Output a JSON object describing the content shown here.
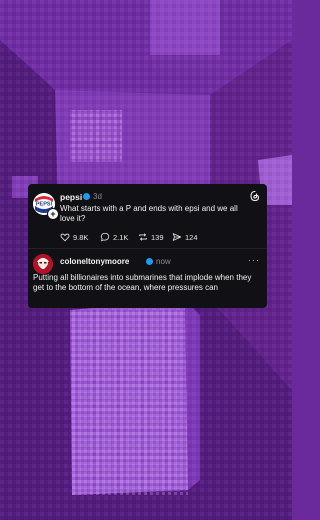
{
  "colors": {
    "accent_verified": "#1d9bf0",
    "card_bg": "#111014",
    "pepsi_blue": "#1b3c8f",
    "pepsi_red": "#e32636",
    "kfc_red": "#b4122a"
  },
  "post": {
    "author": "pepsi",
    "time": "3d",
    "text": "What starts with a P and ends with epsi and we all love it?",
    "avatar_logo_text": "PEPSI",
    "likes": "9.8K",
    "replies": "2.1K",
    "reposts": "139",
    "shares": "124",
    "icons": [
      "heart-icon",
      "comment-icon",
      "repost-icon",
      "share-icon",
      "threads-logo-icon"
    ]
  },
  "reply": {
    "author": "coloneltonymoore",
    "time": "now",
    "more": "···",
    "text": "Putting all billionaires into submarines that implode when they get to the bottom of the ocean, where pressures can"
  }
}
